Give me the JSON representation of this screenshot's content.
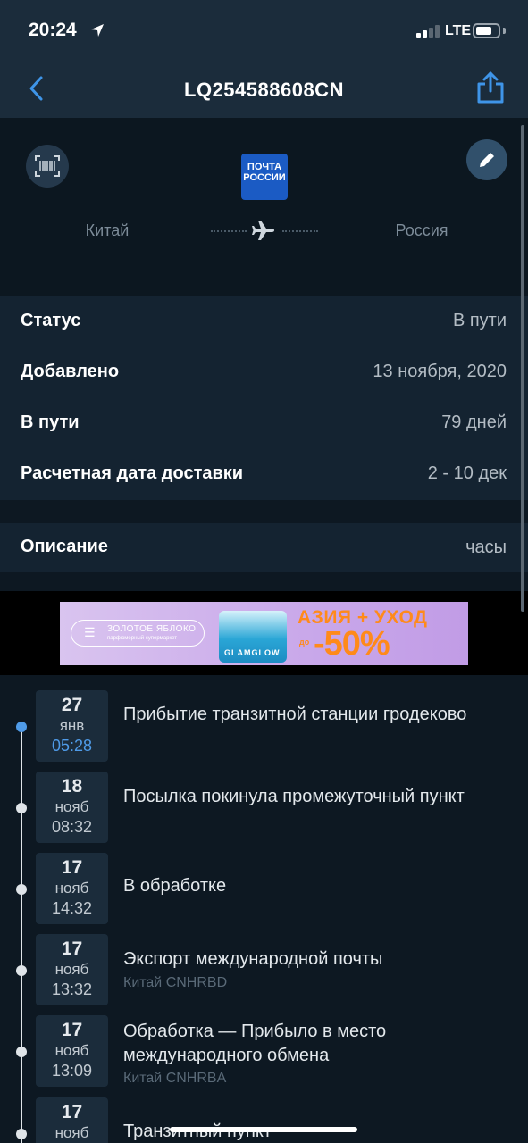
{
  "status_bar": {
    "time": "20:24",
    "network": "LTE"
  },
  "nav": {
    "title": "LQ254588608CN"
  },
  "route": {
    "carrier_line1": "ПОЧТА",
    "carrier_line2": "РОССИИ",
    "origin": "Китай",
    "destination": "Россия"
  },
  "info": [
    {
      "label": "Статус",
      "value": "В пути"
    },
    {
      "label": "Добавлено",
      "value": "13 ноября, 2020"
    },
    {
      "label": "В пути",
      "value": "79 дней"
    },
    {
      "label": "Расчетная дата доставки",
      "value": "2 - 10 дек"
    }
  ],
  "description": {
    "label": "Описание",
    "value": "часы"
  },
  "ad": {
    "brand": "ЗОЛОТОЕ ЯБЛОКО",
    "brand_sub": "парфюмерный супермаркет",
    "product": "GLAMGLOW",
    "headline": "АЗИЯ + УХОД",
    "prefix": "до",
    "discount": "-50%"
  },
  "events": [
    {
      "day": "27",
      "month": "янв",
      "time": "05:28",
      "title": "Прибытие транзитной станции гродеково",
      "location": ""
    },
    {
      "day": "18",
      "month": "нояб",
      "time": "08:32",
      "title": "Посылка покинула промежуточный пункт",
      "location": ""
    },
    {
      "day": "17",
      "month": "нояб",
      "time": "14:32",
      "title": "В обработке",
      "location": ""
    },
    {
      "day": "17",
      "month": "нояб",
      "time": "13:32",
      "title": "Экспорт международной почты",
      "location": "Китай CNHRBD"
    },
    {
      "day": "17",
      "month": "нояб",
      "time": "13:09",
      "title": "Обработка — Прибыло в место международного обмена",
      "location": "Китай CNHRBA"
    },
    {
      "day": "17",
      "month": "нояб",
      "time": "",
      "title": "Транзитный пункт",
      "location": ""
    }
  ],
  "colors": {
    "background": "#0d1822",
    "nav": "#1b2c3b",
    "card": "#142331",
    "accent": "#4f9be8",
    "carrier": "#1b5bc4",
    "ad_orange": "#ff8a1a"
  }
}
